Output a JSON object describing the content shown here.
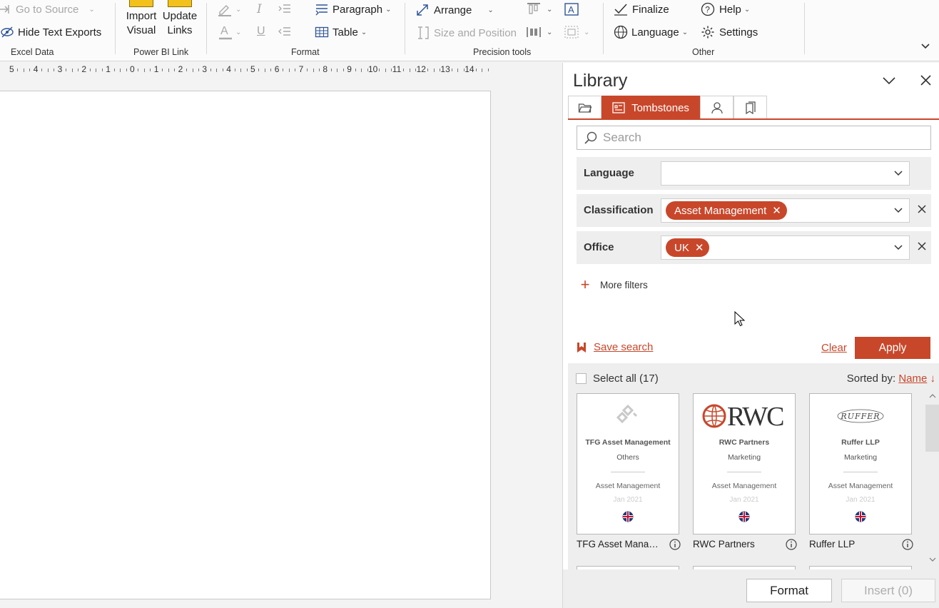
{
  "ribbon": {
    "groups": {
      "excel_data": "Excel Data",
      "power_bi_link": "Power BI Link",
      "format": "Format",
      "precision_tools": "Precision tools",
      "other": "Other"
    },
    "go_to_source": "Go to Source",
    "hide_text_exports": "Hide Text Exports",
    "import_visual": [
      "Import",
      "Visual"
    ],
    "update_links": [
      "Update",
      "Links"
    ],
    "paragraph": "Paragraph",
    "table": "Table",
    "arrange": "Arrange",
    "size_and_position": "Size and Position",
    "finalize": "Finalize",
    "help": "Help",
    "language": "Language",
    "settings": "Settings"
  },
  "ruler": [
    "5",
    "4",
    "3",
    "2",
    "1",
    "0",
    "1",
    "2",
    "3",
    "4",
    "5",
    "6",
    "7",
    "8",
    "9",
    "10",
    "11",
    "12",
    "13",
    "14"
  ],
  "library": {
    "title": "Library",
    "active_tab": "Tombstones",
    "search_placeholder": "Search",
    "filters": [
      {
        "label": "Language",
        "chip": ""
      },
      {
        "label": "Classification",
        "chip": "Asset Management"
      },
      {
        "label": "Office",
        "chip": "UK"
      }
    ],
    "more_filters": "More filters",
    "save_search": "Save search",
    "clear": "Clear",
    "apply": "Apply",
    "select_all": "Select all (17)",
    "sorted_by": "Sorted by:",
    "sort_field": "Name",
    "sort_arrow": "↓",
    "cards": [
      {
        "logo_text": "",
        "name": "TFG Asset Management",
        "category": "Others",
        "classification": "Asset Management",
        "date": "Jan 2021",
        "caption": "TFG Asset Manage..."
      },
      {
        "logo_text": "RWC",
        "name": "RWC Partners",
        "category": "Marketing",
        "classification": "Asset Management",
        "date": "Jan 2021",
        "caption": "RWC Partners"
      },
      {
        "logo_text": "RUFFER",
        "name": "Ruffer LLP",
        "category": "Marketing",
        "classification": "Asset Management",
        "date": "Jan 2021",
        "caption": "Ruffer LLP"
      }
    ],
    "format": "Format",
    "insert": "Insert (0)"
  },
  "colors": {
    "accent": "#c8472b"
  }
}
